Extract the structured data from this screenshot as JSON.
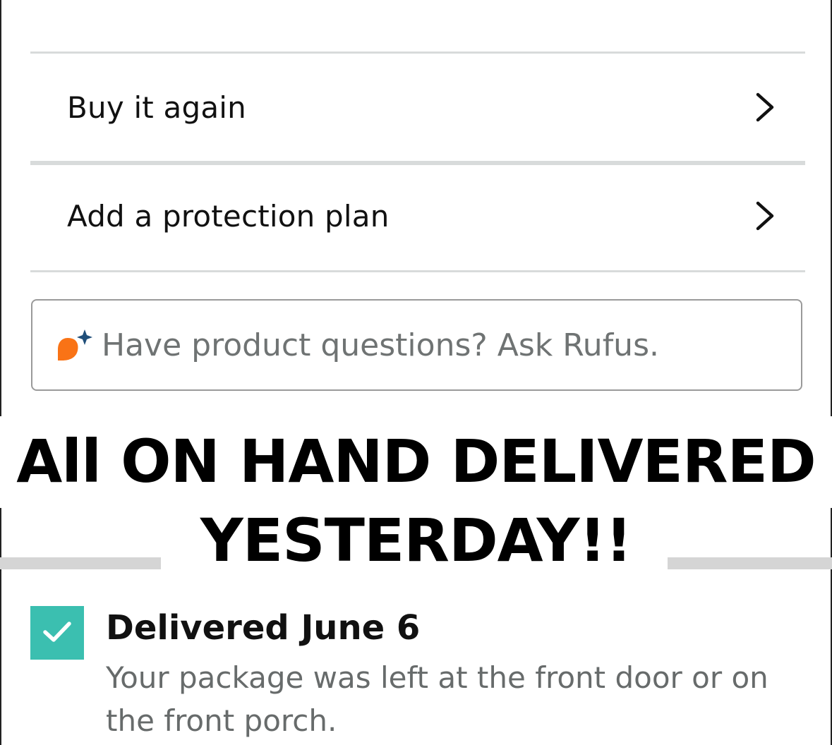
{
  "menu": {
    "items": [
      {
        "label": "Buy it again",
        "icon": "chevron-right-icon"
      },
      {
        "label": "Add a protection plan",
        "icon": "chevron-right-icon"
      }
    ]
  },
  "ask": {
    "placeholder": "Have product questions? Ask Rufus.",
    "icon": "rufus-icon",
    "icon_colors": {
      "bubble": "#f97316",
      "sparkle": "#1f4e79"
    }
  },
  "banner": {
    "line1": "All ON HAND DELIVERED",
    "line2": "YESTERDAY!!"
  },
  "delivery": {
    "title": "Delivered June 6",
    "description": "Your package was left at the front door or on the front porch.",
    "icon": "checkmark-icon",
    "status_color": "#3bbfb0"
  }
}
